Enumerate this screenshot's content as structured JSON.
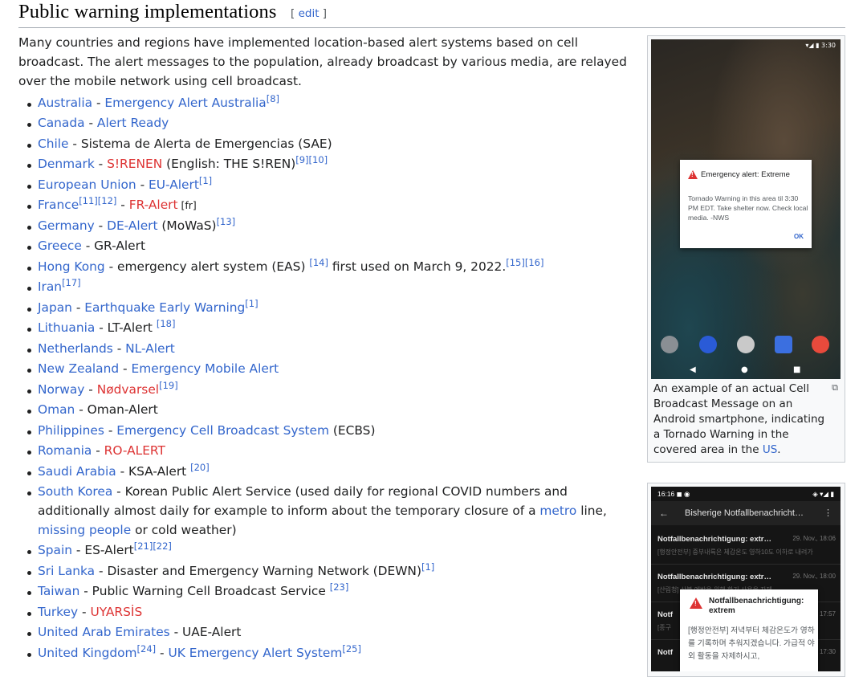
{
  "section": {
    "title": "Public warning implementations",
    "edit_open": "[ ",
    "edit_label": "edit",
    "edit_close": " ]"
  },
  "intro": "Many countries and regions have implemented location-based alert systems based on cell broadcast. The alert messages to the population, already broadcast by various media, are relayed over the mobile network using cell broadcast.",
  "items": {
    "australia": {
      "country": "Australia",
      "sep": " - ",
      "system": "Emergency Alert Australia",
      "ref": "[8]"
    },
    "canada": {
      "country": "Canada",
      "sep": " - ",
      "system": "Alert Ready"
    },
    "chile": {
      "country": "Chile",
      "text": " - Sistema de Alerta de Emergencias (SAE)"
    },
    "denmark": {
      "country": "Denmark",
      "sep": " - ",
      "system": "S!RENEN",
      "text": " (English: THE S!REN)",
      "ref1": "[9]",
      "ref2": "[10]"
    },
    "eu": {
      "country": "European Union",
      "sep": " - ",
      "system": "EU-Alert",
      "ref": "[1]"
    },
    "france": {
      "country": "France",
      "ref1": "[11]",
      "ref2": "[12]",
      "sep": " - ",
      "system": "FR-Alert",
      "lang": " [fr]"
    },
    "germany": {
      "country": "Germany",
      "sep": " - ",
      "system": "DE-Alert",
      "text": " (MoWaS)",
      "ref": "[13]"
    },
    "greece": {
      "country": "Greece",
      "text": " - GR-Alert"
    },
    "hongkong": {
      "country": "Hong Kong",
      "text": " - emergency alert system (EAS) ",
      "ref1": "[14]",
      "text2": " first used on March 9, 2022.",
      "ref2": "[15]",
      "ref3": "[16]"
    },
    "iran": {
      "country": "Iran",
      "ref": "[17]"
    },
    "japan": {
      "country": "Japan",
      "sep": " - ",
      "system": "Earthquake Early Warning",
      "ref": "[1]"
    },
    "lithuania": {
      "country": "Lithuania",
      "text": " - LT-Alert ",
      "ref": "[18]"
    },
    "netherlands": {
      "country": "Netherlands",
      "sep": " - ",
      "system": "NL-Alert"
    },
    "newzealand": {
      "country": "New Zealand",
      "sep": " - ",
      "system": "Emergency Mobile Alert"
    },
    "norway": {
      "country": "Norway",
      "sep": " - ",
      "system": "Nødvarsel",
      "ref": "[19]"
    },
    "oman": {
      "country": "Oman",
      "text": " - Oman-Alert"
    },
    "philippines": {
      "country": "Philippines",
      "sep": " - ",
      "system": "Emergency Cell Broadcast System",
      "text": " (ECBS)"
    },
    "romania": {
      "country": "Romania",
      "sep": " - ",
      "system": "RO-ALERT"
    },
    "saudi": {
      "country": "Saudi Arabia",
      "text": " - KSA-Alert ",
      "ref": "[20]"
    },
    "southkorea": {
      "country": "South Korea",
      "text": " - Korean Public Alert Service (used daily for regional COVID numbers and additionally almost daily for example to inform about the temporary closure of a ",
      "link1": "metro",
      "text2": " line, ",
      "link2": "missing people",
      "text3": " or cold weather)"
    },
    "spain": {
      "country": "Spain",
      "text": " - ES-Alert",
      "ref1": "[21]",
      "ref2": "[22]"
    },
    "srilanka": {
      "country": "Sri Lanka",
      "text": " - Disaster and Emergency Warning Network (DEWN)",
      "ref": "[1]"
    },
    "taiwan": {
      "country": "Taiwan",
      "text": " - Public Warning Cell Broadcast Service ",
      "ref": "[23]"
    },
    "turkey": {
      "country": "Turkey",
      "sep": " - ",
      "system": "UYARSİS"
    },
    "uae": {
      "country": "United Arab Emirates",
      "text": " - UAE-Alert"
    },
    "uk": {
      "country": "United Kingdom",
      "ref1": "[24]",
      "sep": " - ",
      "system": "UK Emergency Alert System",
      "ref2": "[25]"
    }
  },
  "thumb1": {
    "status": "▾◢ ▮ 3:30",
    "dialog_title": "Emergency alert: Extreme",
    "dialog_body": "Tornado Warning in this area til 3:30 PM EDT. Take shelter now. Check local media. -NWS",
    "dialog_ok": "OK",
    "caption": "An example of an actual Cell Broadcast Message on an Android smartphone, indicating a Tornado Warning in the covered area in the ",
    "caption_link": "US",
    "caption_end": "."
  },
  "thumb2": {
    "status_left": "16:16 ◼ ◉",
    "status_right": "◈ ▾◢ ▮",
    "title": "Bisherige Notfallbenachricht…",
    "rows": [
      {
        "title": "Notfallbenachrichtigung: extr…",
        "date": "29. Nov., 18:06",
        "snippet": "[행정안전부] 중부내륙은 체감온도 영하10도 이하로 내려가"
      },
      {
        "title": "Notfallbenachrichtigung: extr…",
        "date": "29. Nov., 18:00",
        "snippet": "[산림청] 산불 예방을 위해 화기 사용을 자제"
      },
      {
        "title": "Notf",
        "date": "17:57",
        "snippet": "[종구"
      },
      {
        "title": "Notf",
        "date": "17:30",
        "snippet": ""
      }
    ],
    "dialog_title": "Notfallbenachrichtigung: extrem",
    "dialog_body": "[행정안전부] 저녁부터 체감온도가 영하를 기록하며 추워지겠습니다. 가급적 야외 활동을 자제하시고,"
  },
  "colors": {
    "link": "#3366cc",
    "redlink": "#dd3333",
    "text": "#202122"
  }
}
